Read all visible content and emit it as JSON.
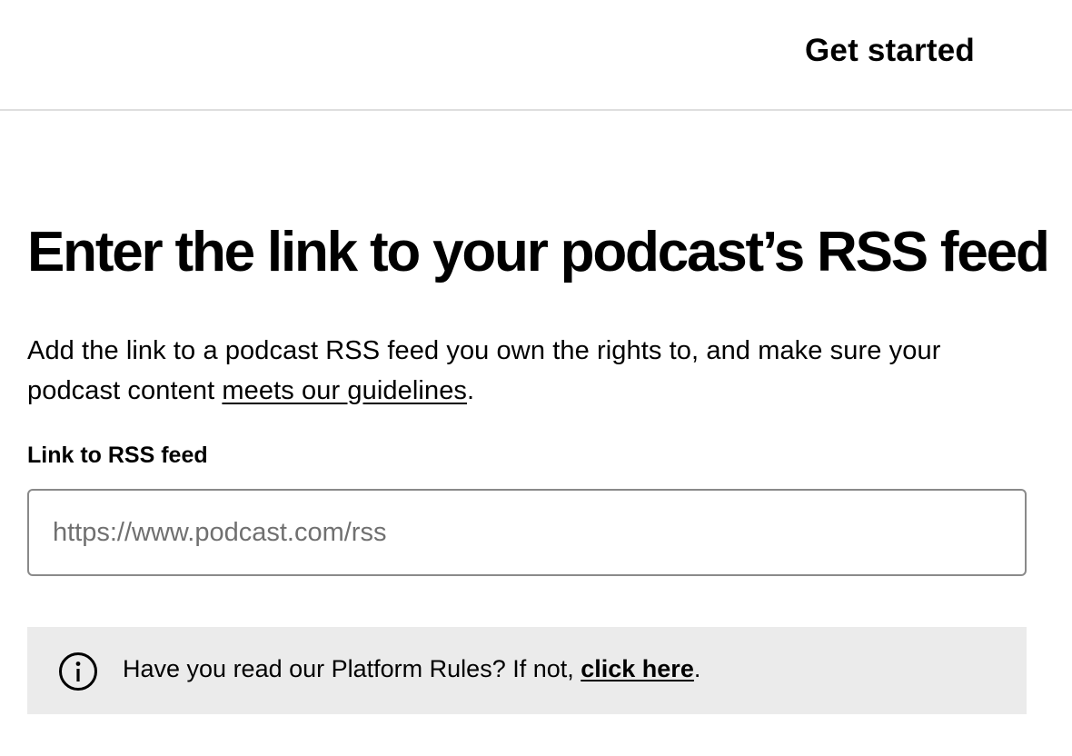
{
  "header": {
    "get_started_label": "Get started"
  },
  "main": {
    "title": "Enter the link to your podcast’s RSS feed",
    "description_prefix": "Add the link to a podcast RSS feed you own the rights to, and make sure your podcast content ",
    "guidelines_link": "meets our guidelines",
    "description_suffix": ".",
    "field_label": "Link to RSS feed",
    "rss_input": {
      "value": "",
      "placeholder": "https://www.podcast.com/rss"
    }
  },
  "notice": {
    "icon": "info-icon",
    "text_prefix": "Have you read our Platform Rules? If not, ",
    "link": "click here",
    "text_suffix": "."
  },
  "colors": {
    "notice_background": "#ebebeb",
    "divider": "#dedede",
    "input_border": "#8a8a8a",
    "placeholder": "#707070"
  }
}
